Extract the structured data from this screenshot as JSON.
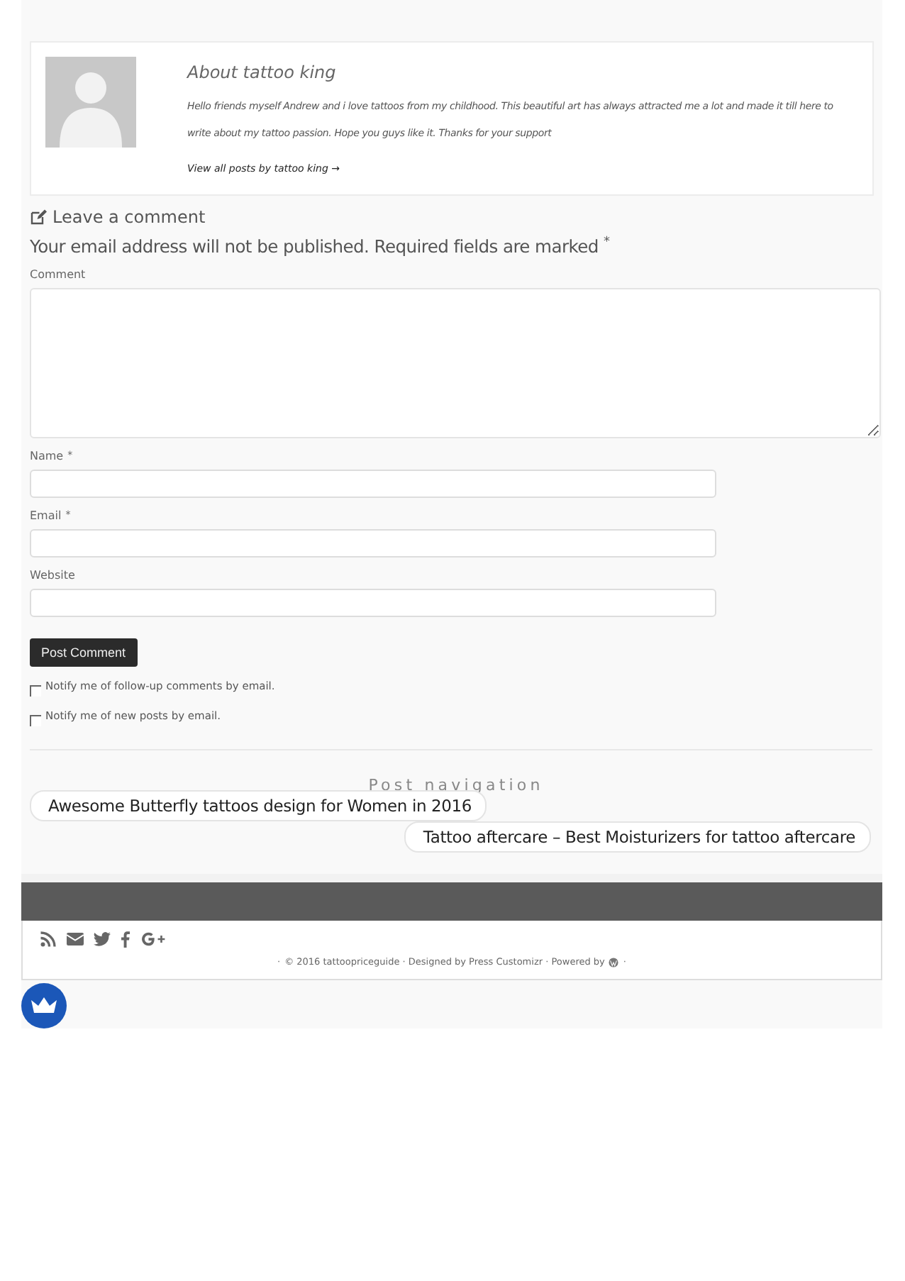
{
  "author_box": {
    "title": "About tattoo king",
    "bio": "Hello friends myself Andrew and i love tattoos from my childhood. This beautiful art has always attracted me a lot and made it till here to write about my tattoo passion. Hope you guys like it. Thanks for your support",
    "link": "View all posts by tattoo king →"
  },
  "comment_form": {
    "heading": "Leave a comment",
    "notice": "Your email address will not be published. Required fields are marked",
    "required_mark": "*",
    "fields": [
      {
        "kind": "textarea",
        "label": "Comment",
        "required": false
      },
      {
        "kind": "text",
        "label": "Name",
        "required": true
      },
      {
        "kind": "text",
        "label": "Email",
        "required": true
      },
      {
        "kind": "text",
        "label": "Website",
        "required": false
      }
    ],
    "submit": "Post Comment",
    "options": [
      {
        "label": "Notify me of follow-up comments by email.",
        "checked": false
      },
      {
        "label": "Notify me of new posts by email.",
        "checked": false
      }
    ]
  },
  "post_navigation": {
    "title": "Post navigation",
    "previous": "Awesome Butterfly tattoos design for Women in 2016",
    "next": "Tattoo aftercare – Best Moisturizers for tattoo aftercare"
  },
  "footer": {
    "social": [
      {
        "kind": "rss"
      },
      {
        "kind": "email"
      },
      {
        "kind": "twitter"
      },
      {
        "kind": "facebook"
      },
      {
        "kind": "google-plus"
      }
    ],
    "credits_lead": "·",
    "credits_text": "© 2016 tattoopriceguide · Designed by Press Customizr · Powered by",
    "credits_end": "·"
  }
}
